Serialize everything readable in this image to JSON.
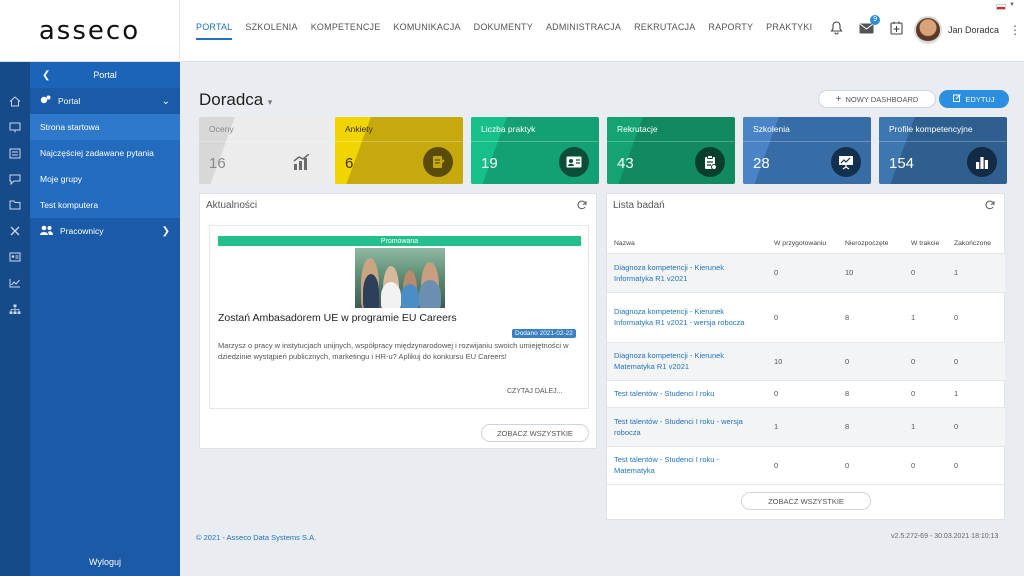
{
  "brand": {
    "logo": "asseco"
  },
  "nav": [
    "PORTAL",
    "SZKOLENIA",
    "KOMPETENCJE",
    "KOMUNIKACJA",
    "DOKUMENTY",
    "ADMINISTRACJA",
    "REKRUTACJA",
    "RAPORTY",
    "PRAKTYKI"
  ],
  "header": {
    "messages_badge": "9",
    "user_name": "Jan Doradca"
  },
  "sidebar": {
    "header": "Portal",
    "group_portal": "Portal",
    "items": [
      "Strona startowa",
      "Najczęściej zadawane pytania",
      "Moje grupy",
      "Test komputera"
    ],
    "group_workers": "Pracownicy",
    "logout": "Wyloguj"
  },
  "page": {
    "title": "Doradca",
    "new_dashboard": "NOWY DASHBOARD",
    "edit": "EDYTUJ"
  },
  "tiles": [
    {
      "label": "Oceny",
      "value": "16",
      "bg": "#ececec",
      "accent": "#d8d8d8",
      "fg": "#888888",
      "icon": "chart-icon"
    },
    {
      "label": "Ankiety",
      "value": "6",
      "bg": "#c6a90d",
      "accent": "#f1d500",
      "fg": "#3a3200",
      "icon": "survey-icon"
    },
    {
      "label": "Liczba praktyk",
      "value": "19",
      "bg": "#13a074",
      "accent": "#17c08a",
      "fg": "#ffffff",
      "icon": "id-card-icon"
    },
    {
      "label": "Rekrutacje",
      "value": "43",
      "bg": "#118a62",
      "accent": "#14a372",
      "fg": "#ffffff",
      "icon": "clipboard-icon"
    },
    {
      "label": "Szkolenia",
      "value": "28",
      "bg": "#386ca6",
      "accent": "#4a84c6",
      "fg": "#ffffff",
      "icon": "presentation-icon"
    },
    {
      "label": "Profile kompetencyjne",
      "value": "154",
      "bg": "#2f5f8f",
      "accent": "#3e76b0",
      "fg": "#ffffff",
      "icon": "bar-chart-icon"
    }
  ],
  "news": {
    "title": "Aktualności",
    "promo": "Promowana",
    "headline": "Zostań Ambasadorem UE w programie EU Careers",
    "date": "Dodano 2021-02-22",
    "body": "Marzysz o pracy w instytucjach unijnych, współpracy międzynarodowej i rozwijaniu swoich umiejętności w dziedzinie wystąpień publicznych, marketingu i HR-u? Aplikuj do konkursu EU Careers!",
    "read_more": "CZYTAJ DALEJ...",
    "see_all": "ZOBACZ WSZYSTKIE"
  },
  "studies": {
    "title": "Lista badań",
    "columns": [
      "Nazwa",
      "W przygotowaniu",
      "Nierozpoczęte",
      "W trakcie",
      "Zakończone"
    ],
    "rows": [
      [
        "Diagnoza kompetencji - Kierunek Informatyka R1 v2021",
        "0",
        "10",
        "0",
        "1"
      ],
      [
        "Diagnoza kompetencji - Kierunek Informatyka R1 v2021 - wersja robocza",
        "0",
        "8",
        "1",
        "0"
      ],
      [
        "Diagnoza kompetencji - Kierunek Matematyka R1 v2021",
        "10",
        "0",
        "0",
        "0"
      ],
      [
        "Test talentów - Studenci I roku",
        "0",
        "8",
        "0",
        "1"
      ],
      [
        "Test talentów - Studenci I roku - wersja robocza",
        "1",
        "8",
        "1",
        "0"
      ],
      [
        "Test talentów - Studenci I roku - Matematyka",
        "0",
        "0",
        "0",
        "0"
      ]
    ],
    "see_all": "ZOBACZ WSZYSTKIE"
  },
  "footer": {
    "copyright": "© 2021 - Asseco Data Systems S.A.",
    "version": "v2.5.272-69 - 30.03.2021 18:10:13"
  }
}
